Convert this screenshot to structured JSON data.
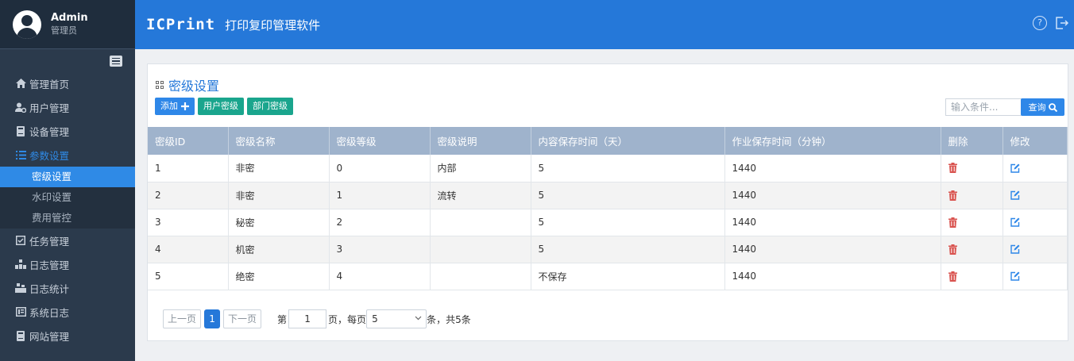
{
  "user": {
    "name": "Admin",
    "role": "管理员"
  },
  "header": {
    "brand": "ICPrint",
    "title": "打印复印管理软件",
    "help_icon": "?"
  },
  "sidebar": {
    "items": [
      {
        "label": "管理首页",
        "icon": "home-icon"
      },
      {
        "label": "用户管理",
        "icon": "user-gear-icon"
      },
      {
        "label": "设备管理",
        "icon": "device-icon"
      },
      {
        "label": "参数设置",
        "icon": "list-icon",
        "active": true
      },
      {
        "label": "任务管理",
        "icon": "task-icon"
      },
      {
        "label": "日志管理",
        "icon": "log-icon"
      },
      {
        "label": "日志统计",
        "icon": "stats-icon"
      },
      {
        "label": "系统日志",
        "icon": "syslog-icon"
      },
      {
        "label": "网站管理",
        "icon": "site-icon"
      }
    ],
    "subitems": [
      {
        "label": "密级设置",
        "current": true
      },
      {
        "label": "水印设置"
      },
      {
        "label": "费用管控"
      }
    ]
  },
  "panel": {
    "title": "密级设置",
    "toolbar": {
      "add": "添加",
      "user_level": "用户密级",
      "dept_level": "部门密级"
    },
    "search": {
      "placeholder": "输入条件...",
      "button": "查询"
    }
  },
  "table": {
    "columns": [
      "密级ID",
      "密级名称",
      "密级等级",
      "密级说明",
      "内容保存时间（天）",
      "作业保存时间（分钟）",
      "删除",
      "修改"
    ],
    "rows": [
      [
        "1",
        "非密",
        "0",
        "内部",
        "5",
        "1440"
      ],
      [
        "2",
        "非密",
        "1",
        "流转",
        "5",
        "1440"
      ],
      [
        "3",
        "秘密",
        "2",
        "",
        "5",
        "1440"
      ],
      [
        "4",
        "机密",
        "3",
        "",
        "5",
        "1440"
      ],
      [
        "5",
        "绝密",
        "4",
        "",
        "不保存",
        "1440"
      ]
    ]
  },
  "pagination": {
    "prev": "上一页",
    "current": "1",
    "next": "下一页",
    "page_prefix": "第",
    "page_input": "1",
    "per_page_text": "页，每页",
    "per_page_value": "5",
    "total_text": "条，共5条"
  },
  "colors": {
    "accent": "#2578d9",
    "sidebar": "#2b3a4c",
    "table_header": "#9fb3cc",
    "green": "#1aa58d",
    "delete": "#d9534f"
  }
}
